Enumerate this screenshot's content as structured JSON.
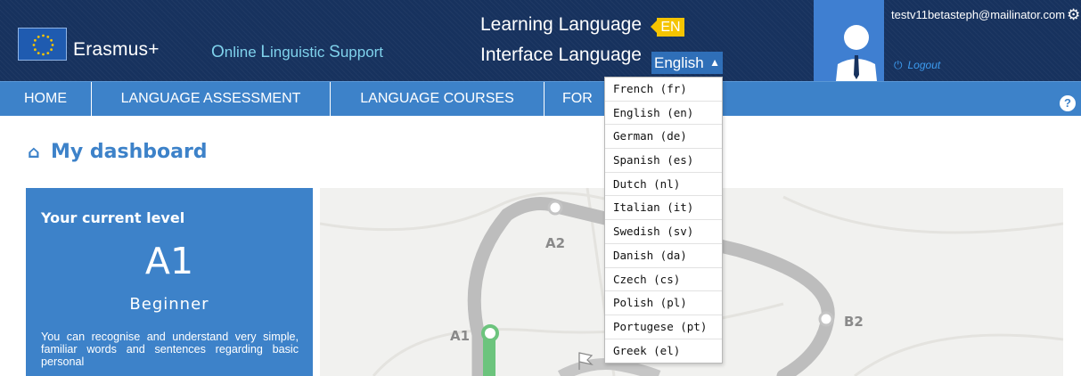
{
  "header": {
    "brand": "Erasmus+",
    "ols": {
      "o": "O",
      "nline": "nline ",
      "l": "L",
      "inguistic": "inguistic ",
      "s": "S",
      "upport": "upport"
    },
    "learning_language_label": "Learning Language",
    "learning_language_code": "EN",
    "interface_language_label": "Interface Language",
    "interface_language_value": "English",
    "user_email": "testv11betasteph@mailinator.com",
    "logout_label": "Logout"
  },
  "nav": {
    "items": [
      "HOME",
      "LANGUAGE ASSESSMENT",
      "LANGUAGE COURSES",
      "FOR"
    ],
    "help_label": "?"
  },
  "dashboard": {
    "title": "My dashboard",
    "card": {
      "heading": "Your current level",
      "level_code": "A1",
      "level_name": "Beginner",
      "description": "You can recognise and understand very simple, familiar words and sentences regarding basic personal"
    },
    "map_labels": {
      "a1": "A1",
      "a2": "A2",
      "b2": "B2"
    }
  },
  "language_menu": {
    "options": [
      "French (fr)",
      "English (en)",
      "German (de)",
      "Spanish (es)",
      "Dutch (nl)",
      "Italian (it)",
      "Swedish (sv)",
      "Danish (da)",
      "Czech (cs)",
      "Polish (pl)",
      "Portugese (pt)",
      "Greek (el)"
    ]
  },
  "colors": {
    "header_bg": "#17325e",
    "nav_bg": "#3d82c9",
    "accent_yellow": "#f5c400",
    "link_cyan": "#7fd2ec",
    "path_green": "#6cc47d"
  },
  "icons": [
    "eu-flag-icon",
    "user-avatar-icon",
    "gear-icon",
    "power-icon",
    "help-icon",
    "home-icon",
    "chevron-updown-icon",
    "flag-icon"
  ]
}
